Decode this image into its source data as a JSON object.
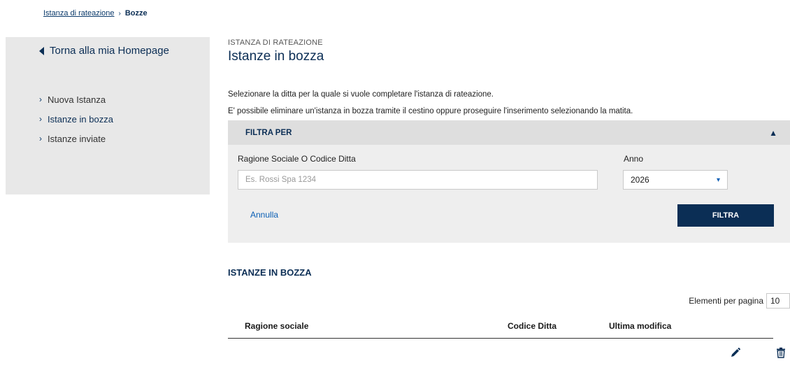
{
  "breadcrumb": {
    "parent": "Istanza di rateazione",
    "current": "Bozze"
  },
  "sidebar": {
    "back_label": "Torna alla mia Homepage",
    "items": [
      {
        "label": "Nuova Istanza"
      },
      {
        "label": "Istanze in bozza",
        "active": true
      },
      {
        "label": "Istanze inviate"
      }
    ]
  },
  "header": {
    "eyebrow": "ISTANZA DI RATEAZIONE",
    "title": "Istanze in bozza"
  },
  "intro": {
    "line1": "Selezionare la ditta per la quale si vuole completare l'istanza di rateazione.",
    "line2": "E' possibile eliminare un'istanza in bozza tramite il cestino oppure proseguire l'inserimento selezionando la matita."
  },
  "filter": {
    "title": "FILTRA PER",
    "ragione_label": "Ragione Sociale O Codice Ditta",
    "ragione_placeholder": "Es. Rossi Spa 1234",
    "anno_label": "Anno",
    "anno_value": "2026",
    "cancel_label": "Annulla",
    "submit_label": "FILTRA"
  },
  "list": {
    "title": "ISTANZE IN BOZZA",
    "per_page_label": "Elementi per pagina",
    "per_page_value": "10",
    "columns": [
      "Ragione sociale",
      "Codice Ditta",
      "Ultima modifica"
    ]
  },
  "icons": {
    "edit": "pencil-icon",
    "delete": "trash-icon",
    "accent": "#0b2e55"
  }
}
